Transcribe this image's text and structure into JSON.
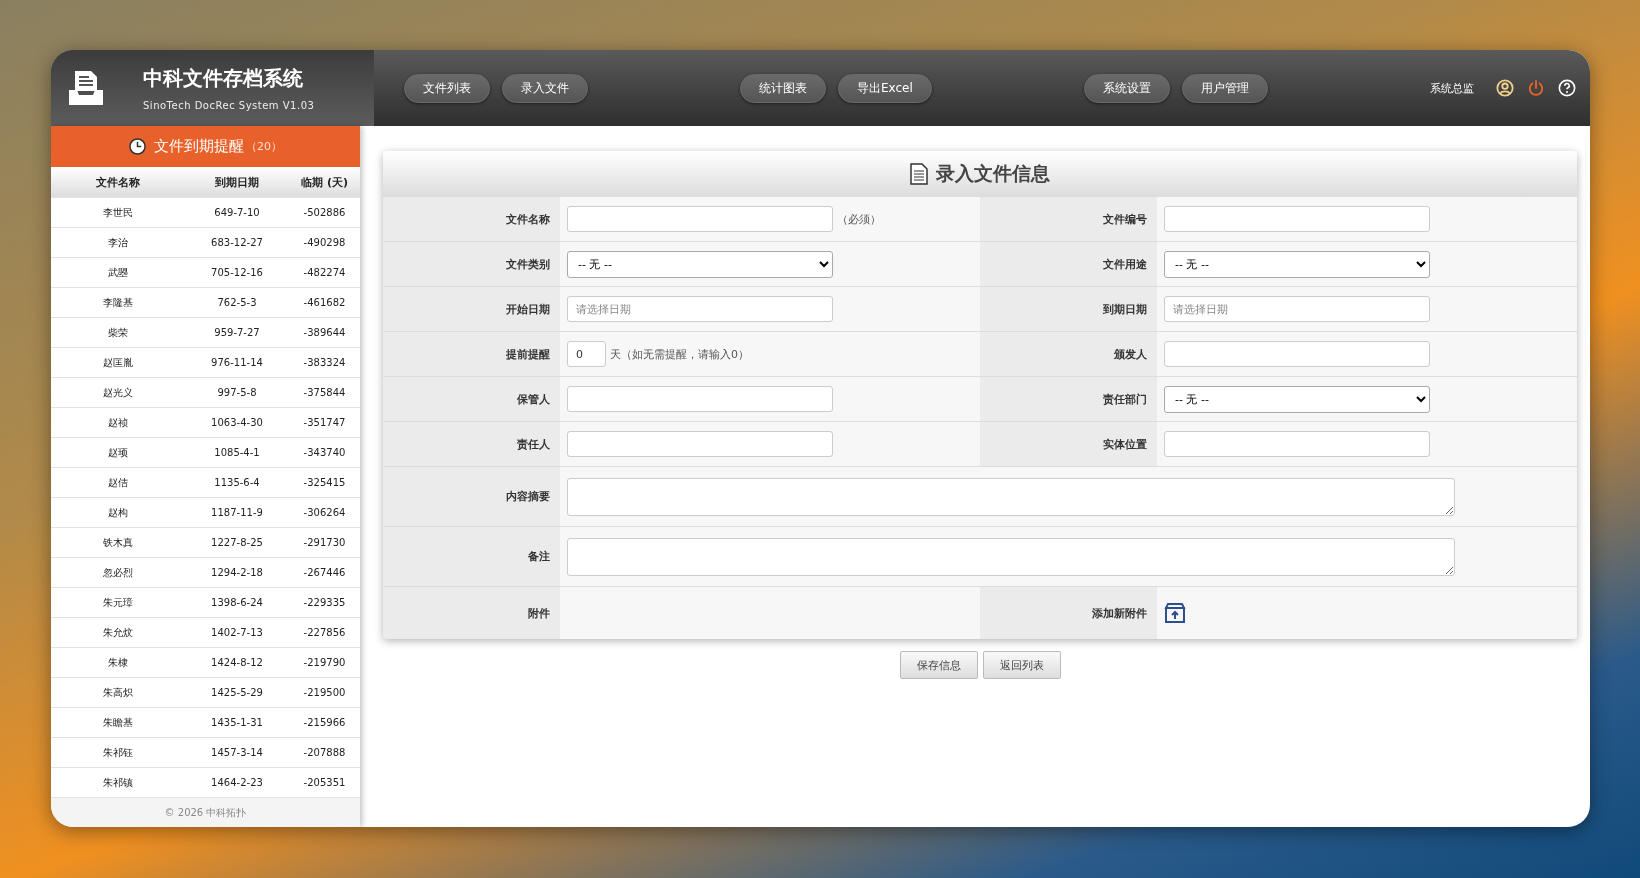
{
  "brand": {
    "title": "中科文件存档系统",
    "subtitle": "SinoTech DocRec System V1.03"
  },
  "nav_groups": [
    [
      "文件列表",
      "录入文件"
    ],
    [
      "统计图表",
      "导出Excel"
    ],
    [
      "系统设置",
      "用户管理"
    ]
  ],
  "user": "系统总监",
  "reminder": {
    "title": "文件到期提醒",
    "count": "（20）",
    "columns": [
      "文件名称",
      "到期日期",
      "临期 (天)"
    ],
    "rows": [
      [
        "李世民",
        "649-7-10",
        "-502886"
      ],
      [
        "李治",
        "683-12-27",
        "-490298"
      ],
      [
        "武曌",
        "705-12-16",
        "-482274"
      ],
      [
        "李隆基",
        "762-5-3",
        "-461682"
      ],
      [
        "柴荣",
        "959-7-27",
        "-389644"
      ],
      [
        "赵匡胤",
        "976-11-14",
        "-383324"
      ],
      [
        "赵光义",
        "997-5-8",
        "-375844"
      ],
      [
        "赵祯",
        "1063-4-30",
        "-351747"
      ],
      [
        "赵顼",
        "1085-4-1",
        "-343740"
      ],
      [
        "赵佶",
        "1135-6-4",
        "-325415"
      ],
      [
        "赵构",
        "1187-11-9",
        "-306264"
      ],
      [
        "铁木真",
        "1227-8-25",
        "-291730"
      ],
      [
        "忽必烈",
        "1294-2-18",
        "-267446"
      ],
      [
        "朱元璋",
        "1398-6-24",
        "-229335"
      ],
      [
        "朱允炆",
        "1402-7-13",
        "-227856"
      ],
      [
        "朱棣",
        "1424-8-12",
        "-219790"
      ],
      [
        "朱高炽",
        "1425-5-29",
        "-219500"
      ],
      [
        "朱瞻基",
        "1435-1-31",
        "-215966"
      ],
      [
        "朱祁钰",
        "1457-3-14",
        "-207888"
      ],
      [
        "朱祁镇",
        "1464-2-23",
        "-205351"
      ]
    ],
    "footer": "© 2026 中科拓扑"
  },
  "form": {
    "title": "录入文件信息",
    "rows": [
      {
        "kind": "pair",
        "cells": [
          {
            "label": "文件名称",
            "field": {
              "kind": "text"
            },
            "note": "（必须）"
          },
          {
            "label": "文件编号",
            "field": {
              "kind": "text"
            }
          }
        ]
      },
      {
        "kind": "pair",
        "cells": [
          {
            "label": "文件类别",
            "field": {
              "kind": "select",
              "value": "-- 无 --"
            }
          },
          {
            "label": "文件用途",
            "field": {
              "kind": "select",
              "value": "-- 无 --"
            }
          }
        ]
      },
      {
        "kind": "pair",
        "cells": [
          {
            "label": "开始日期",
            "field": {
              "kind": "text",
              "placeholder": "请选择日期"
            }
          },
          {
            "label": "到期日期",
            "field": {
              "kind": "text",
              "placeholder": "请选择日期"
            }
          }
        ]
      },
      {
        "kind": "pair",
        "cells": [
          {
            "label": "提前提醒",
            "field": {
              "kind": "number",
              "value": "0"
            },
            "note": "天（如无需提醒，请输入0）"
          },
          {
            "label": "颁发人",
            "field": {
              "kind": "text"
            }
          }
        ]
      },
      {
        "kind": "pair",
        "cells": [
          {
            "label": "保管人",
            "field": {
              "kind": "text"
            }
          },
          {
            "label": "责任部门",
            "field": {
              "kind": "select",
              "value": "-- 无 --"
            }
          }
        ]
      },
      {
        "kind": "pair",
        "cells": [
          {
            "label": "责任人",
            "field": {
              "kind": "text"
            }
          },
          {
            "label": "实体位置",
            "field": {
              "kind": "text"
            }
          }
        ]
      },
      {
        "kind": "wide",
        "cells": [
          {
            "label": "内容摘要",
            "field": {
              "kind": "textarea"
            }
          }
        ]
      },
      {
        "kind": "wide",
        "cells": [
          {
            "label": "备注",
            "field": {
              "kind": "textarea"
            }
          }
        ]
      },
      {
        "kind": "pair",
        "cells": [
          {
            "label": "附件"
          },
          {
            "label": "添加新附件",
            "field": {
              "kind": "upload"
            }
          }
        ]
      }
    ]
  },
  "actions": [
    "保存信息",
    "返回列表"
  ]
}
